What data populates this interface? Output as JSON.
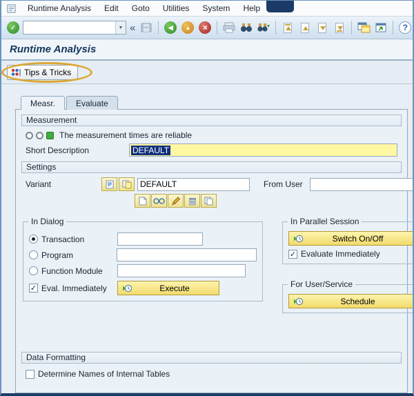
{
  "menubar": {
    "items": [
      {
        "label": "Runtime Analysis"
      },
      {
        "label": "Edit"
      },
      {
        "label": "Goto"
      },
      {
        "label": "Utilities"
      },
      {
        "label": "System"
      },
      {
        "label": "Help"
      }
    ]
  },
  "toolbar": {
    "command_value": ""
  },
  "icons": {
    "enter": "✓",
    "back": "◀",
    "exit": "▲",
    "cancel": "×",
    "collapse": "«",
    "dropdown": "▼",
    "help": "?"
  },
  "header": {
    "title": "Runtime Analysis"
  },
  "app_toolbar": {
    "tips_and_tricks_label": "Tips & Tricks"
  },
  "tabs": [
    {
      "label": "Measr.",
      "active": true
    },
    {
      "label": "Evaluate",
      "active": false
    }
  ],
  "measurement": {
    "section_title": "Measurement",
    "status_message": "The measurement times are reliable",
    "short_description": {
      "label": "Short Description",
      "value": "DEFAULT"
    }
  },
  "settings": {
    "section_title": "Settings",
    "variant": {
      "label": "Variant",
      "value": "DEFAULT"
    },
    "from_user": {
      "label": "From User",
      "value": ""
    }
  },
  "in_dialog": {
    "title": "In Dialog",
    "options": [
      {
        "label": "Transaction",
        "selected": true,
        "value": ""
      },
      {
        "label": "Program",
        "selected": false,
        "value": ""
      },
      {
        "label": "Function Module",
        "selected": false,
        "value": ""
      }
    ],
    "eval_immediately": {
      "label": "Eval. Immediately",
      "checked": true
    },
    "execute_label": "Execute"
  },
  "in_parallel_session": {
    "title": "In Parallel Session",
    "switch_label": "Switch On/Off",
    "evaluate_immediately": {
      "label": "Evaluate Immediately",
      "checked": true
    }
  },
  "for_user_service": {
    "title": "For User/Service",
    "schedule_label": "Schedule"
  },
  "data_formatting": {
    "section_title": "Data Formatting",
    "checkbox_label": "Determine Names of Internal Tables",
    "checked": false
  },
  "colors": {
    "accent_yellow": "#f2db6c",
    "selection_blue": "#10307a",
    "focus_yellow": "#fff8a2",
    "status_green": "#3fae3f"
  }
}
